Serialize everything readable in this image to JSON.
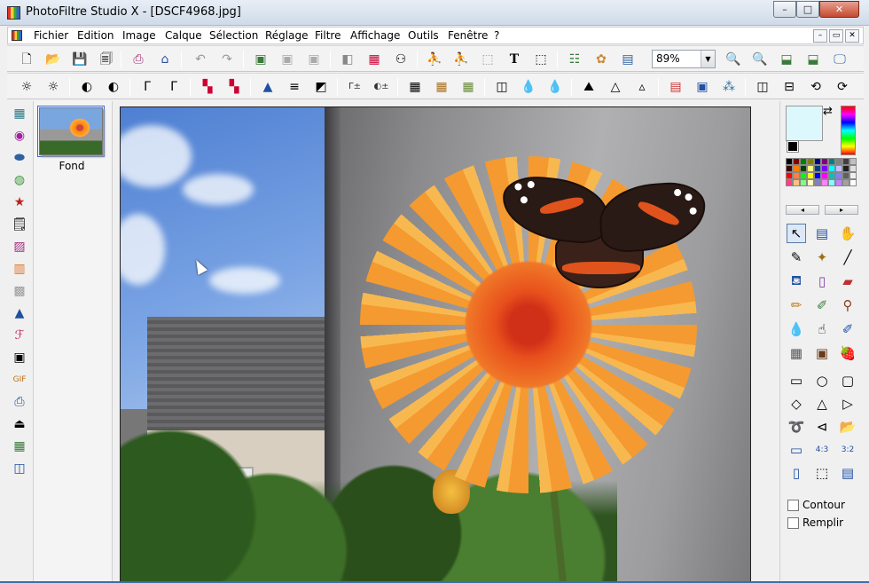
{
  "window": {
    "title": "PhotoFiltre Studio X - [DSCF4968.jpg]",
    "buttons": {
      "minimize": "–",
      "maximize": "□",
      "close": "✕"
    }
  },
  "menu": {
    "items": [
      "Fichier",
      "Edition",
      "Image",
      "Calque",
      "Sélection",
      "Réglage",
      "Filtre",
      "Affichage",
      "Outils",
      "Fenêtre",
      "?"
    ],
    "mdi_buttons": [
      "–",
      "▭",
      "✕"
    ]
  },
  "toolbar_main": {
    "zoom_value": "89%",
    "text_tool_glyph": "T"
  },
  "layers": {
    "items": [
      {
        "name": "Fond"
      }
    ]
  },
  "color_panel": {
    "foreground_color": "#ddf8fc",
    "background_color": "#000000",
    "palette": [
      "#000000",
      "#800000",
      "#008000",
      "#808000",
      "#000080",
      "#800080",
      "#008080",
      "#808080",
      "#404040",
      "#c0c0c0",
      "#400000",
      "#ff8000",
      "#004000",
      "#ffff80",
      "#004080",
      "#8000ff",
      "#00ffff",
      "#c0c0ff",
      "#202020",
      "#e0e0e0",
      "#ff0000",
      "#ff8040",
      "#00ff00",
      "#ffff00",
      "#0000ff",
      "#ff00ff",
      "#00c0c0",
      "#8080ff",
      "#606060",
      "#f0f0f0",
      "#ff4080",
      "#ffc080",
      "#80ff80",
      "#ffffc0",
      "#8080c0",
      "#ff80ff",
      "#80ffff",
      "#c080ff",
      "#a0a0a0",
      "#ffffff"
    ],
    "nav_prev": "◂",
    "nav_next": "▸"
  },
  "options": {
    "contour_label": "Contour",
    "contour_checked": false,
    "fill_label": "Remplir",
    "fill_checked": false
  },
  "zoom_tools": {
    "zoom_in": "+",
    "zoom_out": "−"
  }
}
